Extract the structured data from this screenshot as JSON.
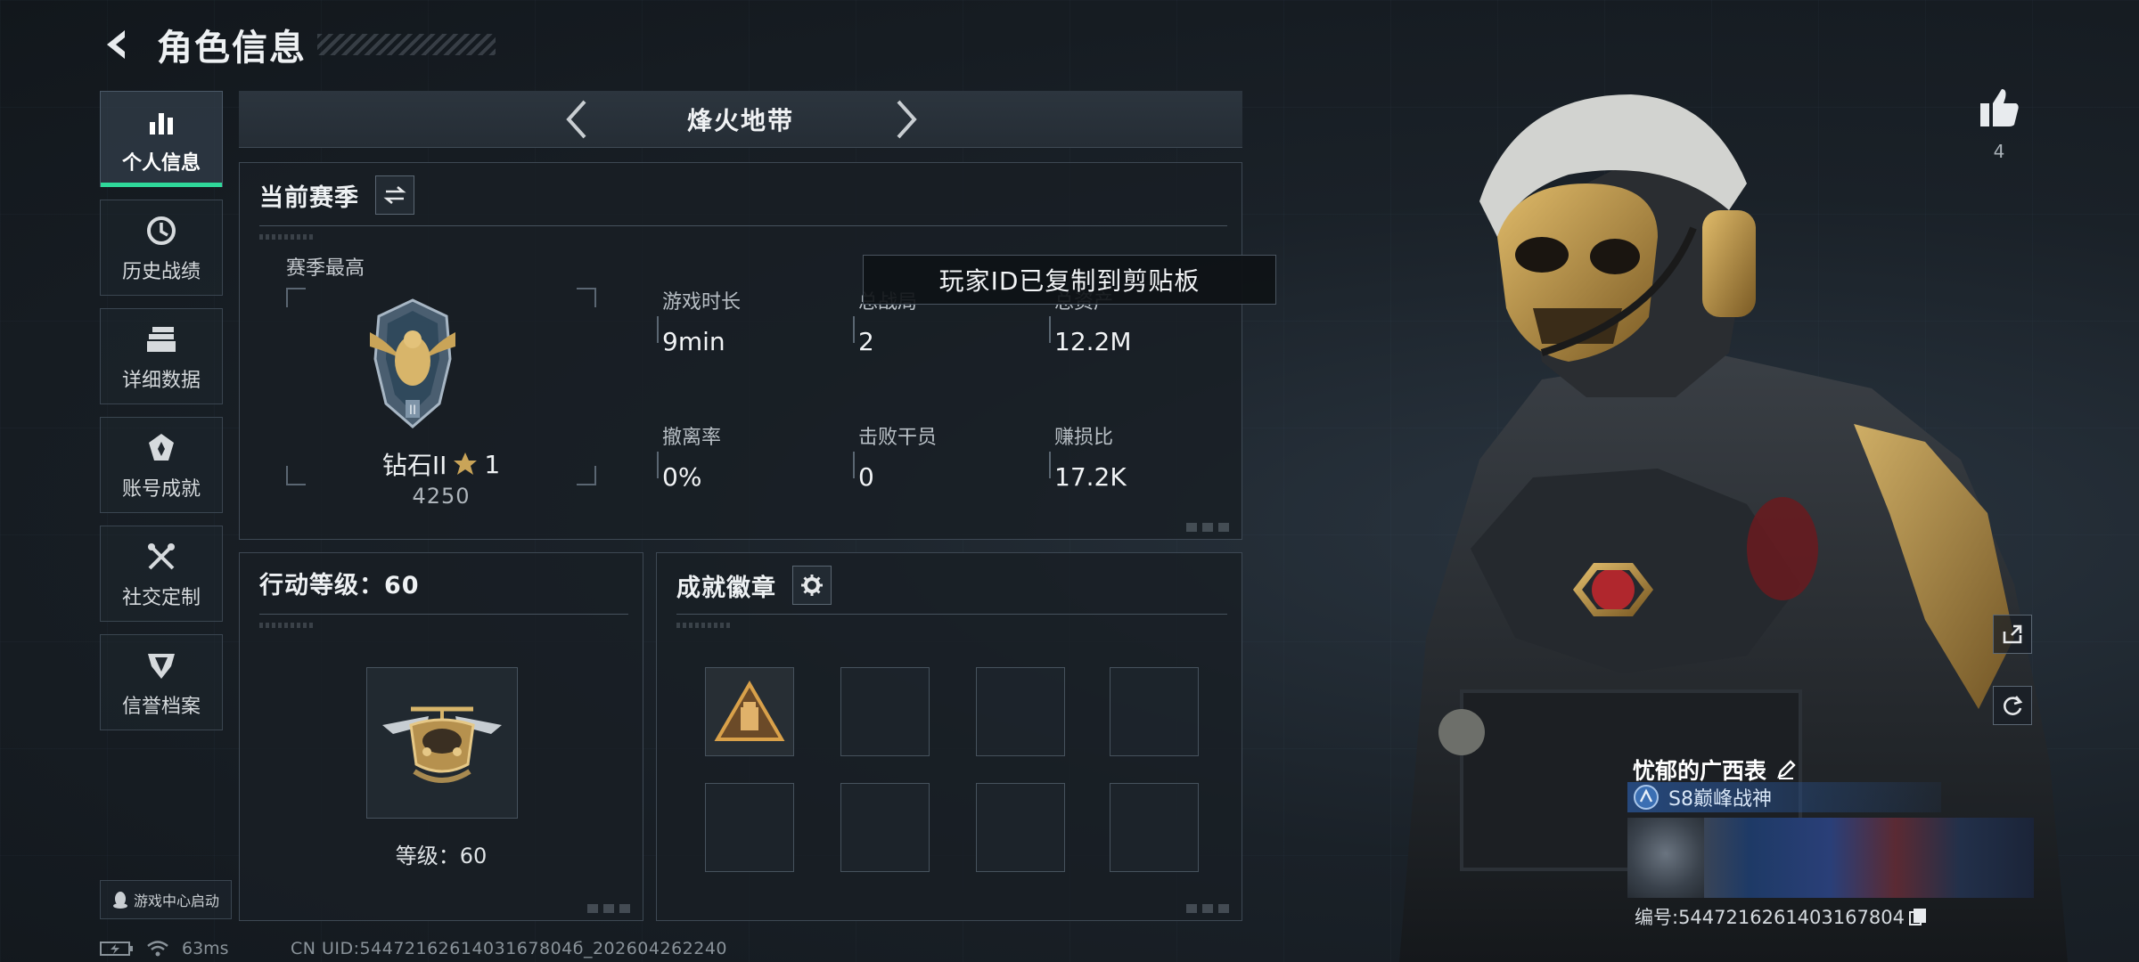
{
  "header": {
    "title": "角色信息"
  },
  "sidebar": {
    "items": [
      {
        "label": "个人信息",
        "icon": "bar-chart-icon",
        "active": true
      },
      {
        "label": "历史战绩",
        "icon": "history-clock-icon",
        "active": false
      },
      {
        "label": "详细数据",
        "icon": "folder-icon",
        "active": false
      },
      {
        "label": "账号成就",
        "icon": "achievement-icon",
        "active": false
      },
      {
        "label": "社交定制",
        "icon": "wrench-icon",
        "active": false
      },
      {
        "label": "信誉档案",
        "icon": "credit-shield-icon",
        "active": false
      }
    ],
    "game_center": "游戏中心启动"
  },
  "mode_switch": {
    "current": "烽火地带"
  },
  "season": {
    "title": "当前赛季",
    "best_label": "赛季最高",
    "rank_name": "钻石II",
    "rank_stars": "1",
    "rank_score": "4250",
    "stats": [
      {
        "key": "游戏时长",
        "value": "9min"
      },
      {
        "key": "总战局",
        "value": "2"
      },
      {
        "key": "总资产",
        "value": "12.2M"
      },
      {
        "key": "撤离率",
        "value": "0%"
      },
      {
        "key": "击败干员",
        "value": "0"
      },
      {
        "key": "赚损比",
        "value": "17.2K"
      }
    ]
  },
  "action_level": {
    "title": "行动等级：60",
    "level_text": "等级：60"
  },
  "achievements": {
    "title": "成就徽章",
    "slots_total": 8,
    "slots_filled": 1
  },
  "toast": {
    "text": "玩家ID已复制到剪贴板"
  },
  "like": {
    "count": "4"
  },
  "player": {
    "name": "忧郁的广西表",
    "title": "S8巅峰战神",
    "id_text": "编号:5447216261403167804"
  },
  "status": {
    "ping": "63ms",
    "uid": "CN UID:5447216261403167804б_202604262240"
  },
  "colors": {
    "accent": "#2fd89a",
    "panel_border": "#3d4853",
    "title_badge": "#28508c"
  }
}
